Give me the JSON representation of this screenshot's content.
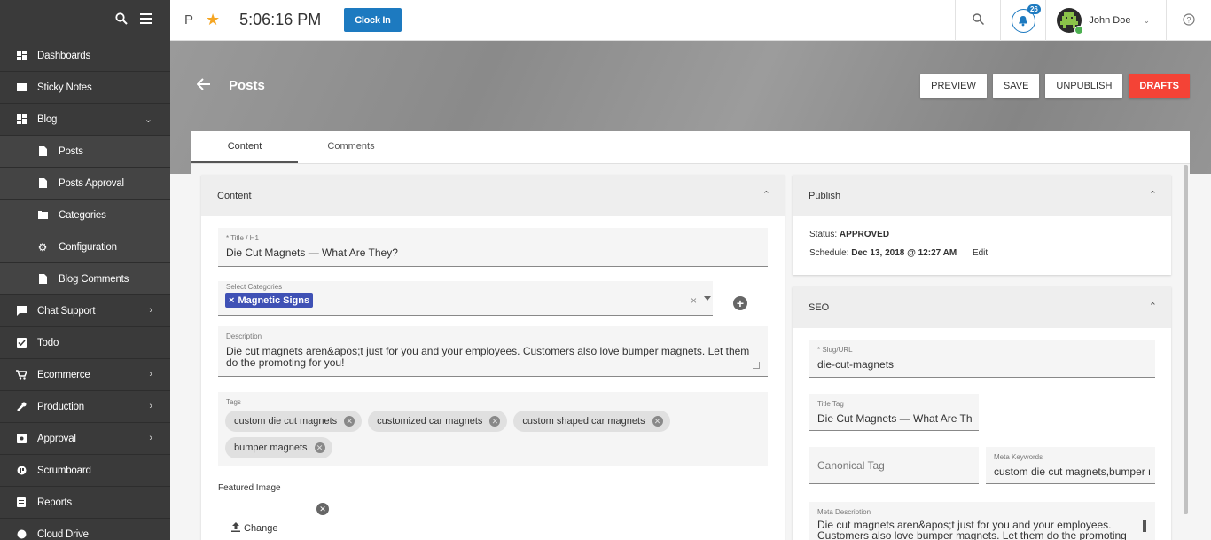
{
  "sidebar": {
    "items": [
      {
        "label": "Dashboards",
        "icon": "dashboard-icon"
      },
      {
        "label": "Sticky Notes",
        "icon": "note-icon"
      },
      {
        "label": "Blog",
        "icon": "blog-icon"
      },
      {
        "label": "Posts",
        "icon": "file-icon"
      },
      {
        "label": "Posts Approval",
        "icon": "file-icon"
      },
      {
        "label": "Categories",
        "icon": "folder-icon"
      },
      {
        "label": "Configuration",
        "icon": "gear-icon"
      },
      {
        "label": "Blog Comments",
        "icon": "file-icon"
      },
      {
        "label": "Chat Support",
        "icon": "chat-icon"
      },
      {
        "label": "Todo",
        "icon": "check-icon"
      },
      {
        "label": "Ecommerce",
        "icon": "cart-icon"
      },
      {
        "label": "Production",
        "icon": "wrench-icon"
      },
      {
        "label": "Approval",
        "icon": "approval-icon"
      },
      {
        "label": "Scrumboard",
        "icon": "board-icon"
      },
      {
        "label": "Reports",
        "icon": "report-icon"
      },
      {
        "label": "Cloud Drive",
        "icon": "cloud-icon"
      }
    ]
  },
  "topbar": {
    "p": "P",
    "time": "5:06:16 PM",
    "clock_in": "Clock In",
    "badge_count": "26",
    "user_name": "John Doe"
  },
  "banner": {
    "title": "Posts",
    "preview": "PREVIEW",
    "save": "SAVE",
    "unpublish": "UNPUBLISH",
    "drafts": "DRAFTS"
  },
  "tabs": [
    "Content",
    "Comments"
  ],
  "content": {
    "heading": "Content",
    "title_label": "* Title / H1",
    "title_value": "Die Cut Magnets — What Are They?",
    "categories_label": "Select Categories",
    "category_chip": "Magnetic Signs",
    "desc_label": "Description",
    "desc_line1": "Die cut magnets aren&apos;t just for you and your employees. Customers also love bumper magnets. Let them",
    "desc_line2": "do the promoting for you!",
    "tags_label": "Tags",
    "tags": [
      "custom die cut magnets",
      "customized car magnets",
      "custom shaped car magnets",
      "bumper magnets"
    ],
    "featured_label": "Featured Image",
    "change": "Change"
  },
  "publish": {
    "heading": "Publish",
    "status_label": "Status:",
    "status_value": "APPROVED",
    "schedule_label": "Schedule:",
    "schedule_value": "Dec 13, 2018 @ 12:27 AM",
    "edit": "Edit"
  },
  "seo": {
    "heading": "SEO",
    "slug_label": "* Slug/URL",
    "slug_value": "die-cut-magnets",
    "title_tag_label": "Title Tag",
    "title_tag_value": "Die Cut Magnets — What Are They?",
    "canonical_placeholder": "Canonical Tag",
    "meta_kw_label": "Meta Keywords",
    "meta_kw_value": "custom die cut magnets,bumper magnets",
    "meta_desc_label": "Meta Description",
    "meta_desc_line1": "Die cut magnets aren&apos;t just for you and your employees.",
    "meta_desc_line2": "Customers also love bumper magnets. Let them do the promoting"
  }
}
